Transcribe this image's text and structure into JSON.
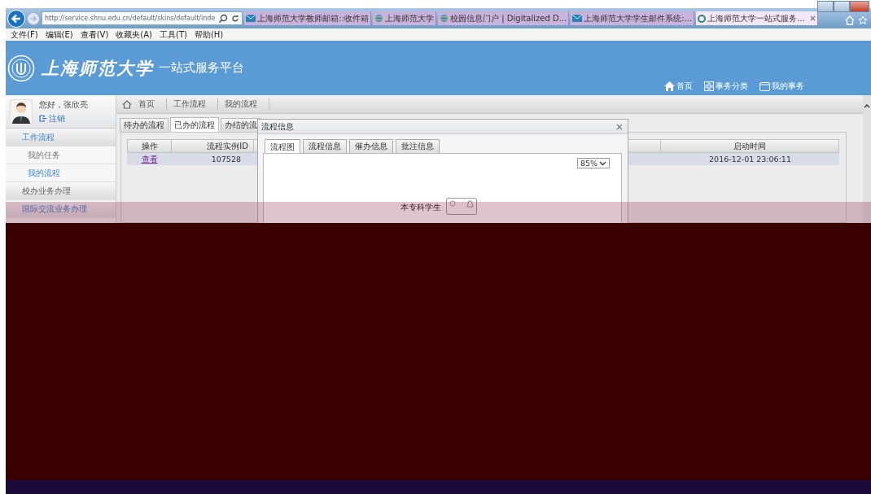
{
  "browser": {
    "address": "http://service.shnu.edu.cn/default/skins/default/inde",
    "tabs": [
      {
        "label": "上海师范大学教师邮箱::收件箱",
        "kind": "mail",
        "selected": false
      },
      {
        "label": "上海师范大学",
        "kind": "ie",
        "selected": false
      },
      {
        "label": "校园信息门户 | Digitalized D...",
        "kind": "ie",
        "selected": false
      },
      {
        "label": "上海师范大学学生邮件系统:...",
        "kind": "mail",
        "selected": false
      },
      {
        "label": "上海师范大学一站式服务...",
        "kind": "site",
        "selected": true
      }
    ],
    "menu": [
      "文件(F)",
      "编辑(E)",
      "查看(V)",
      "收藏夹(A)",
      "工具(T)",
      "帮助(H)"
    ]
  },
  "header": {
    "university": "上海师范大学",
    "platform": "一站式服务平台",
    "nav": [
      {
        "label": "首页",
        "kind": "home"
      },
      {
        "label": "事务分类",
        "kind": "grid"
      },
      {
        "label": "我的事务",
        "kind": "box"
      }
    ]
  },
  "sidebar": {
    "greeting": "您好，张欣亮",
    "logout": "注销",
    "items": [
      {
        "label": "工作流程",
        "kind": "section",
        "selected": true
      },
      {
        "label": "我的任务",
        "kind": "item",
        "selected": false
      },
      {
        "label": "我的流程",
        "kind": "item",
        "selected": true
      },
      {
        "label": "校办业务办理",
        "kind": "section",
        "selected": false
      },
      {
        "label": "国际交流业务办理",
        "kind": "section",
        "selected": true
      }
    ]
  },
  "breadcrumb": [
    "首页",
    "工作流程",
    "我的流程"
  ],
  "tabs": [
    {
      "label": "待办的流程",
      "selected": false
    },
    {
      "label": "已办的流程",
      "selected": true
    },
    {
      "label": "办结的流",
      "selected": false
    }
  ],
  "table": {
    "columns": [
      "操作",
      "流程实例ID",
      "启动时间"
    ],
    "rows": [
      {
        "action": "查看",
        "id": "107528",
        "start": "2016-12-01 23:06:11",
        "selected": true
      }
    ]
  },
  "dialog": {
    "title": "流程信息",
    "tabs": [
      {
        "label": "流程图",
        "selected": true
      },
      {
        "label": "流程信息",
        "selected": false
      },
      {
        "label": "催办信息",
        "selected": false
      },
      {
        "label": "批注信息",
        "selected": false
      }
    ],
    "zoom": "85%",
    "node_label": "本专科学生"
  }
}
